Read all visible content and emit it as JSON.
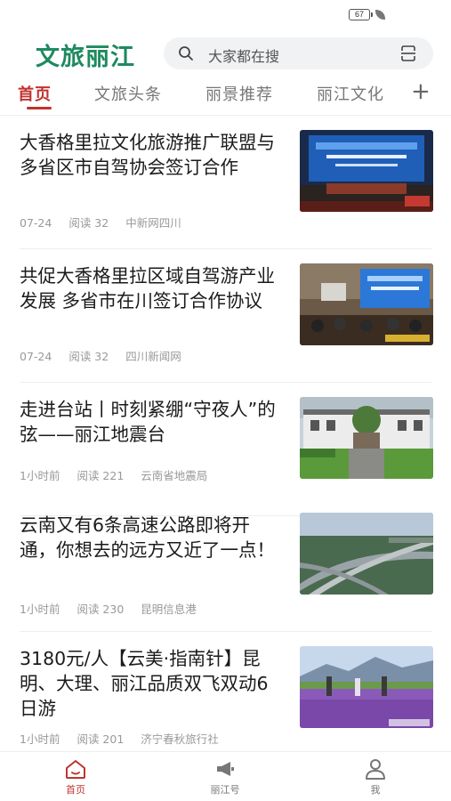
{
  "status_bar": {
    "battery": "67"
  },
  "header": {
    "logo": "文旅丽江",
    "search_placeholder": "大家都在搜"
  },
  "tabs": [
    {
      "label": "首页",
      "active": true
    },
    {
      "label": "文旅头条"
    },
    {
      "label": "丽景推荐"
    },
    {
      "label": "丽江文化"
    }
  ],
  "tabs_add": "+",
  "news": [
    {
      "title": "大香格里拉文化旅游推广联盟与多省区市自驾协会签订合作",
      "time": "07-24",
      "reads": "阅读 32",
      "source": "中新网四川",
      "thumb": "conference-stage"
    },
    {
      "title": "共促大香格里拉区域自驾游产业发展 多省市在川签订合作协议",
      "time": "07-24",
      "reads": "阅读 32",
      "source": "四川新闻网",
      "thumb": "conference-hall"
    },
    {
      "title": "走进台站丨时刻紧绷“守夜人”的弦——丽江地震台",
      "time": "1小时前",
      "reads": "阅读 221",
      "source": "云南省地震局",
      "thumb": "station-building"
    },
    {
      "title": "云南又有6条高速公路即将开通，你想去的远方又近了一点！",
      "time": "1小时前",
      "reads": "阅读 230",
      "source": "昆明信息港",
      "thumb": "highway-aerial"
    },
    {
      "title": "3180元/人【云美·指南针】昆明、大理、丽江品质双飞双动6日游",
      "time": "1小时前",
      "reads": "阅读 201",
      "source": "济宁春秋旅行社",
      "thumb": "flower-field"
    }
  ],
  "bottom_nav": [
    {
      "label": "首页",
      "icon": "home-icon",
      "active": true
    },
    {
      "label": "丽江号",
      "icon": "megaphone-icon"
    },
    {
      "label": "我",
      "icon": "person-icon"
    }
  ],
  "colors": {
    "brand_green": "#1e8a5f",
    "accent_red": "#c0332f"
  }
}
